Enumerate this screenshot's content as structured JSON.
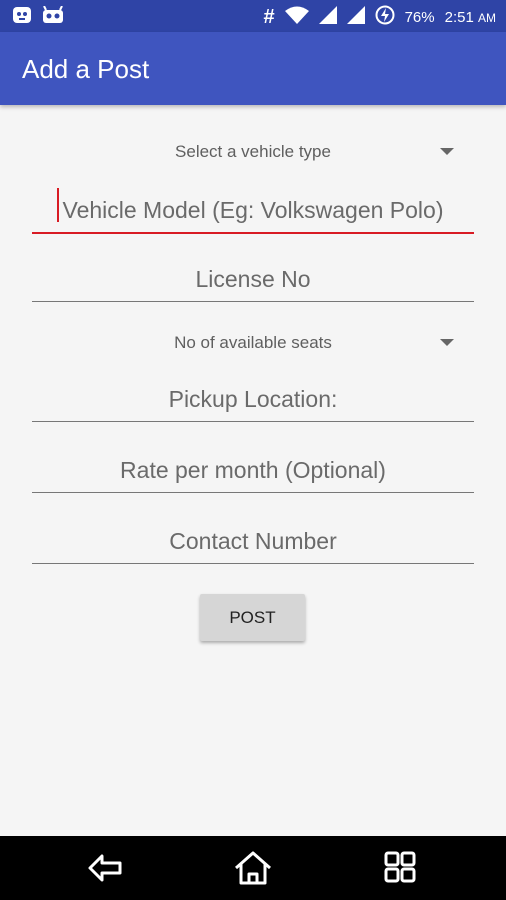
{
  "status_bar": {
    "battery": "76%",
    "time": "2:51",
    "ampm": "AM",
    "icons": [
      "app-notification-icon",
      "android-debug-icon",
      "hash-icon",
      "wifi-icon",
      "signal-icon",
      "signal-icon",
      "battery-charging-icon"
    ]
  },
  "app_bar": {
    "title": "Add a Post"
  },
  "form": {
    "vehicle_type_spinner": "Select a vehicle type",
    "vehicle_model_placeholder": "Vehicle Model (Eg: Volkswagen Polo)",
    "license_placeholder": "License No",
    "seats_spinner": "No of available seats",
    "pickup_placeholder": "Pickup Location:",
    "rate_placeholder": "Rate per month (Optional)",
    "contact_placeholder": "Contact Number",
    "post_label": "POST"
  },
  "nav_bar": {
    "icons": [
      "back-icon",
      "home-icon",
      "recents-icon"
    ]
  },
  "colors": {
    "status_bar": "#2f44a6",
    "app_bar": "#3f55bf",
    "accent": "#d81b24"
  }
}
